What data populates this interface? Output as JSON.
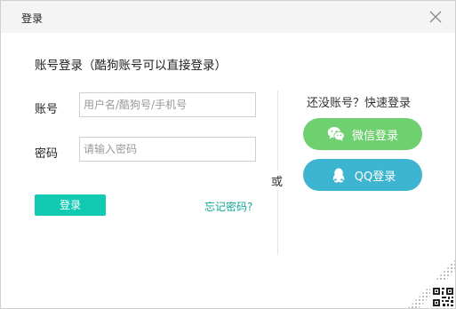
{
  "dialog": {
    "title": "登录",
    "heading": "账号登录（酷狗账号可以直接登录）"
  },
  "form": {
    "account_label": "账号",
    "account_placeholder": "用户名/酷狗号/手机号",
    "password_label": "密码",
    "password_placeholder": "请输入密码",
    "login_button": "登录",
    "forgot_link": "忘记密码?"
  },
  "separator": {
    "or_text": "或"
  },
  "quick_login": {
    "heading": "还没账号？快速登录",
    "wechat_label": "微信登录",
    "qq_label": "QQ登录"
  },
  "colors": {
    "primary": "#12c9b1",
    "wechat": "#6fd06f",
    "qq": "#3eb5d0"
  },
  "icons": [
    "close-icon",
    "wechat-icon",
    "qq-icon",
    "qr-code-icon"
  ]
}
